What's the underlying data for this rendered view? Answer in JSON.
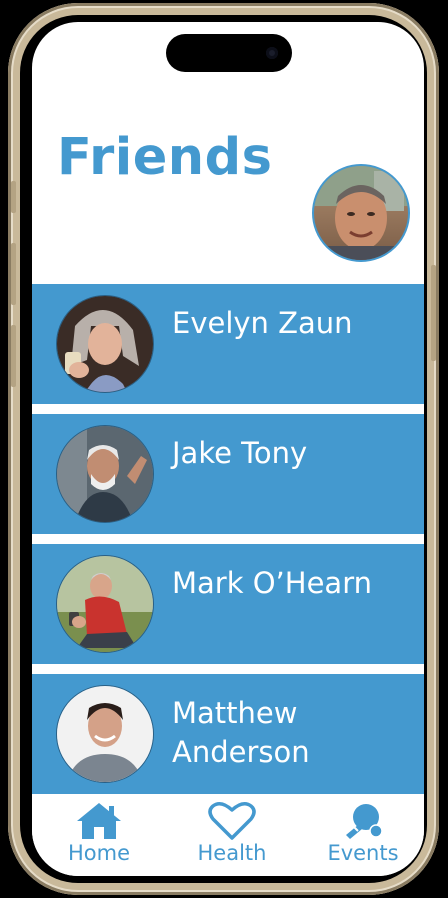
{
  "page": {
    "title": "Friends"
  },
  "friends": [
    {
      "name": "Evelyn Zaun"
    },
    {
      "name": "Jake Tony"
    },
    {
      "name": "Mark O’Hearn"
    },
    {
      "name": "Matthew\nAnderson"
    }
  ],
  "tabs": {
    "home": {
      "label": "Home",
      "icon": "home-icon"
    },
    "health": {
      "label": "Health",
      "icon": "heart-icon"
    },
    "events": {
      "label": "Events",
      "icon": "ping-pong-icon"
    }
  },
  "colors": {
    "accent": "#4499cf",
    "row_background": "#4499cf",
    "text_on_accent": "#ffffff"
  }
}
